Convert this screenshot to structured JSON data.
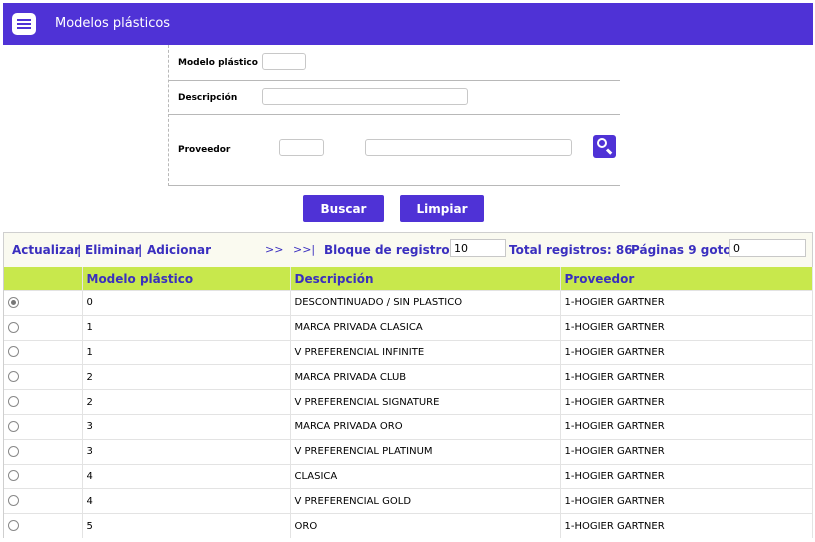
{
  "header": {
    "title": "Modelos plásticos",
    "logo_icon": "document-list-icon"
  },
  "form": {
    "modelo_label": "Modelo plástico",
    "modelo_value": "",
    "descripcion_label": "Descripción",
    "descripcion_value": "",
    "proveedor_label": "Proveedor",
    "proveedor_code": "",
    "proveedor_name": "",
    "search_icon": "magnifier-icon"
  },
  "buttons": {
    "buscar": "Buscar",
    "limpiar": "Limpiar"
  },
  "toolbar": {
    "actualizar": "Actualizar",
    "eliminar": "Eliminar",
    "adicionar": "Adicionar",
    "sep": "|",
    "next": ">>",
    "last": ">>|",
    "bloque_label": "Bloque de registros:",
    "bloque_value": "10",
    "total_label": "Total registros: 86",
    "paginas_label": "Páginas 9 goto:",
    "goto_value": "0"
  },
  "table": {
    "headers": [
      "",
      "Modelo plástico",
      "Descripción",
      "Proveedor"
    ],
    "rows": [
      {
        "selected": true,
        "modelo": "0",
        "descripcion": "DESCONTINUADO / SIN PLASTICO",
        "proveedor": "1-HOGIER GARTNER"
      },
      {
        "selected": false,
        "modelo": "1",
        "descripcion": "MARCA PRIVADA CLASICA",
        "proveedor": "1-HOGIER GARTNER"
      },
      {
        "selected": false,
        "modelo": "1",
        "descripcion": "V PREFERENCIAL INFINITE",
        "proveedor": "1-HOGIER GARTNER"
      },
      {
        "selected": false,
        "modelo": "2",
        "descripcion": "MARCA PRIVADA CLUB",
        "proveedor": "1-HOGIER GARTNER"
      },
      {
        "selected": false,
        "modelo": "2",
        "descripcion": "V PREFERENCIAL SIGNATURE",
        "proveedor": "1-HOGIER GARTNER"
      },
      {
        "selected": false,
        "modelo": "3",
        "descripcion": "MARCA PRIVADA ORO",
        "proveedor": "1-HOGIER GARTNER"
      },
      {
        "selected": false,
        "modelo": "3",
        "descripcion": "V PREFERENCIAL PLATINUM",
        "proveedor": "1-HOGIER GARTNER"
      },
      {
        "selected": false,
        "modelo": "4",
        "descripcion": "CLASICA",
        "proveedor": "1-HOGIER GARTNER"
      },
      {
        "selected": false,
        "modelo": "4",
        "descripcion": "V PREFERENCIAL GOLD",
        "proveedor": "1-HOGIER GARTNER"
      },
      {
        "selected": false,
        "modelo": "5",
        "descripcion": "ORO",
        "proveedor": "1-HOGIER GARTNER"
      }
    ]
  },
  "colors": {
    "brand": "#4f32d6",
    "header_row": "#c8e84c",
    "link": "#3a2fbf"
  }
}
